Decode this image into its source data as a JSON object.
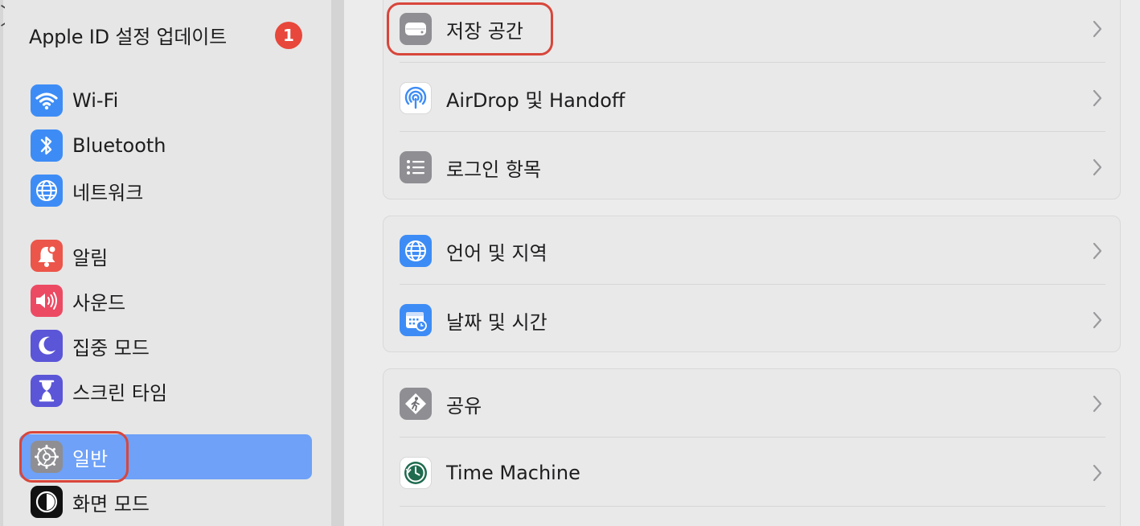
{
  "sidebar": {
    "update": {
      "label": "Apple ID 설정 업데이트",
      "badge": "1"
    },
    "items": [
      {
        "key": "wifi",
        "label": "Wi-Fi",
        "icon": "wifi-icon",
        "color": "#3d8cf6"
      },
      {
        "key": "bluetooth",
        "label": "Bluetooth",
        "icon": "bluetooth-icon",
        "color": "#3d8cf6"
      },
      {
        "key": "network",
        "label": "네트워크",
        "icon": "globe-icon",
        "color": "#3d8cf6"
      },
      {
        "key": "notifications",
        "label": "알림",
        "icon": "bell-icon",
        "color": "#ec5549"
      },
      {
        "key": "sound",
        "label": "사운드",
        "icon": "speaker-icon",
        "color": "#ec4a63"
      },
      {
        "key": "focus",
        "label": "집중 모드",
        "icon": "moon-icon",
        "color": "#5b55d8"
      },
      {
        "key": "screentime",
        "label": "스크린 타임",
        "icon": "hourglass-icon",
        "color": "#5b55d8"
      },
      {
        "key": "general",
        "label": "일반",
        "icon": "gear-icon",
        "color": "#8e8e93",
        "selected": true
      },
      {
        "key": "appearance",
        "label": "화면 모드",
        "icon": "appearance-icon",
        "color": "#111111"
      }
    ]
  },
  "main": {
    "groups": [
      {
        "rows": [
          {
            "key": "storage",
            "label": "저장 공간",
            "icon": "drive-icon"
          },
          {
            "key": "airdrop",
            "label": "AirDrop 및 Handoff",
            "icon": "airdrop-icon"
          },
          {
            "key": "login",
            "label": "로그인 항목",
            "icon": "list-icon"
          }
        ]
      },
      {
        "rows": [
          {
            "key": "language",
            "label": "언어 및 지역",
            "icon": "globe-icon"
          },
          {
            "key": "datetime",
            "label": "날짜 및 시간",
            "icon": "calendar-clock-icon"
          }
        ]
      },
      {
        "rows": [
          {
            "key": "sharing",
            "label": "공유",
            "icon": "sharing-icon"
          },
          {
            "key": "timemachine",
            "label": "Time Machine",
            "icon": "time-machine-icon"
          }
        ]
      }
    ]
  },
  "colors": {
    "accent": "#6ea1f7",
    "badge": "#e8473b",
    "highlight": "#d8463b"
  }
}
